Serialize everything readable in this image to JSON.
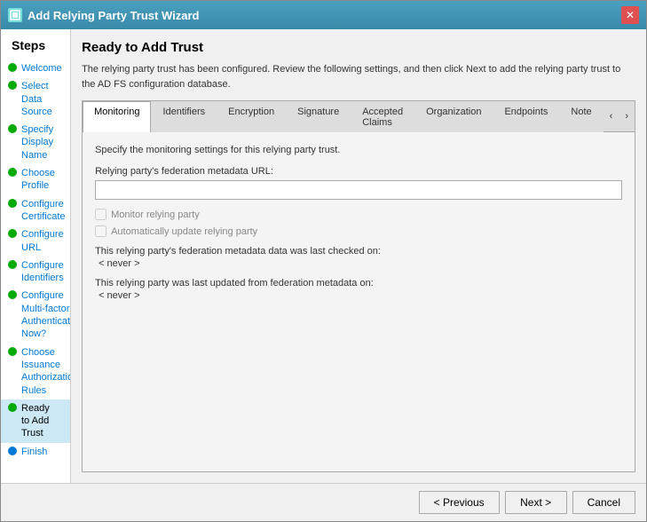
{
  "window": {
    "title": "Add Relying Party Trust Wizard",
    "close_btn_label": "✕"
  },
  "sidebar": {
    "title": "Steps",
    "items": [
      {
        "id": "welcome",
        "label": "Welcome",
        "dot": "green",
        "active": false
      },
      {
        "id": "select-data-source",
        "label": "Select Data Source",
        "dot": "green",
        "active": false
      },
      {
        "id": "specify-display-name",
        "label": "Specify Display Name",
        "dot": "green",
        "active": false
      },
      {
        "id": "choose-profile",
        "label": "Choose Profile",
        "dot": "green",
        "active": false
      },
      {
        "id": "configure-certificate",
        "label": "Configure Certificate",
        "dot": "green",
        "active": false
      },
      {
        "id": "configure-url",
        "label": "Configure URL",
        "dot": "green",
        "active": false
      },
      {
        "id": "configure-identifiers",
        "label": "Configure Identifiers",
        "dot": "green",
        "active": false
      },
      {
        "id": "configure-multifactor",
        "label": "Configure Multi-factor Authentication Now?",
        "dot": "green",
        "active": false
      },
      {
        "id": "choose-issuance",
        "label": "Choose Issuance Authorization Rules",
        "dot": "green",
        "active": false
      },
      {
        "id": "ready-to-add",
        "label": "Ready to Add Trust",
        "dot": "green",
        "active": true
      },
      {
        "id": "finish",
        "label": "Finish",
        "dot": "blue",
        "active": false
      }
    ]
  },
  "main": {
    "page_title": "Ready to Add Trust",
    "description": "The relying party trust has been configured. Review the following settings, and then click Next to add the relying party trust to the AD FS configuration database.",
    "tabs": [
      {
        "id": "monitoring",
        "label": "Monitoring",
        "active": true
      },
      {
        "id": "identifiers",
        "label": "Identifiers",
        "active": false
      },
      {
        "id": "encryption",
        "label": "Encryption",
        "active": false
      },
      {
        "id": "signature",
        "label": "Signature",
        "active": false
      },
      {
        "id": "accepted-claims",
        "label": "Accepted Claims",
        "active": false
      },
      {
        "id": "organization",
        "label": "Organization",
        "active": false
      },
      {
        "id": "endpoints",
        "label": "Endpoints",
        "active": false
      },
      {
        "id": "notes",
        "label": "Note",
        "active": false
      }
    ],
    "tab_nav_prev": "‹",
    "tab_nav_next": "›",
    "monitoring": {
      "description": "Specify the monitoring settings for this relying party trust.",
      "url_label": "Relying party's federation metadata URL:",
      "url_value": "",
      "url_placeholder": "",
      "checkbox1_label": "Monitor relying party",
      "checkbox2_label": "Automatically update relying party",
      "last_checked_label": "This relying party's federation metadata data was last checked on:",
      "last_checked_value": "< never >",
      "last_updated_label": "This relying party was last updated from federation metadata on:",
      "last_updated_value": "< never >"
    }
  },
  "footer": {
    "previous_label": "< Previous",
    "next_label": "Next >",
    "cancel_label": "Cancel"
  }
}
